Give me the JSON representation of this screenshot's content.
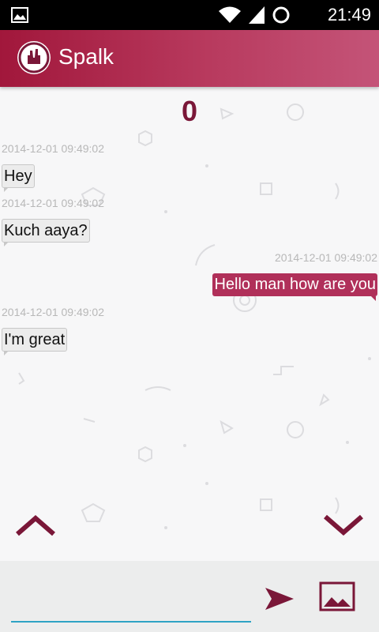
{
  "status_bar": {
    "time": "21:49",
    "icons": [
      "image-icon",
      "wifi-icon",
      "signal-icon",
      "sync-icon"
    ]
  },
  "app": {
    "title": "Spalk",
    "logo_icon": "hand-icon",
    "accent_color": "#a1173b"
  },
  "chat": {
    "counter": "0",
    "messages": [
      {
        "timestamp": "2014-12-01 09:49:02",
        "text": "Hey",
        "direction": "incoming"
      },
      {
        "timestamp": "2014-12-01 09:49:02",
        "text": "Kuch aaya?",
        "direction": "incoming"
      },
      {
        "timestamp": "2014-12-01 09:49:02",
        "text": "Hello man how are you",
        "direction": "outgoing"
      },
      {
        "timestamp": "2014-12-01 09:49:02",
        "text": "I'm great",
        "direction": "incoming"
      }
    ]
  },
  "controls": {
    "scroll_up_icon": "chevron-up-icon",
    "scroll_down_icon": "chevron-down-icon"
  },
  "composer": {
    "input_value": "",
    "input_placeholder": "",
    "send_icon": "send-icon",
    "image_icon": "image-icon"
  }
}
